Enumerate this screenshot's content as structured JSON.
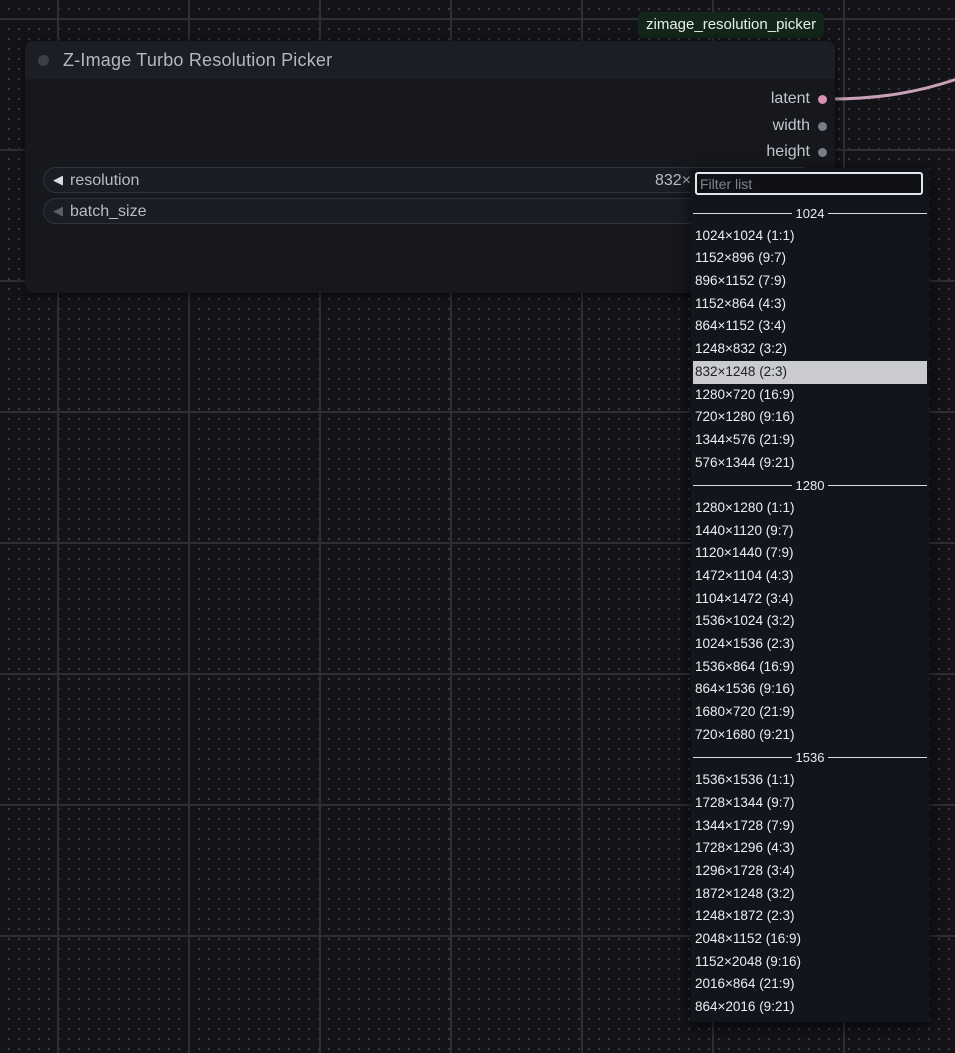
{
  "node": {
    "badge": "zimage_resolution_picker",
    "title": "Z-Image Turbo Resolution Picker",
    "outputs": [
      "latent",
      "width",
      "height"
    ],
    "widgets": {
      "resolution": {
        "label": "resolution",
        "value": "832×"
      },
      "batch_size": {
        "label": "batch_size"
      }
    }
  },
  "dropdown": {
    "filter_placeholder": "Filter list",
    "selected": "832×1248 (2:3)",
    "groups": [
      {
        "header": "1024",
        "items": [
          "1024×1024 (1:1)",
          "1152×896 (9:7)",
          "896×1152 (7:9)",
          "1152×864 (4:3)",
          "864×1152 (3:4)",
          "1248×832 (3:2)",
          "832×1248 (2:3)",
          "1280×720 (16:9)",
          "720×1280 (9:16)",
          "1344×576 (21:9)",
          "576×1344 (9:21)"
        ]
      },
      {
        "header": "1280",
        "items": [
          "1280×1280 (1:1)",
          "1440×1120 (9:7)",
          "1120×1440 (7:9)",
          "1472×1104 (4:3)",
          "1104×1472 (3:4)",
          "1536×1024 (3:2)",
          "1024×1536 (2:3)",
          "1536×864 (16:9)",
          "864×1536 (9:16)",
          "1680×720 (21:9)",
          "720×1680 (9:21)"
        ]
      },
      {
        "header": "1536",
        "items": [
          "1536×1536 (1:1)",
          "1728×1344 (9:7)",
          "1344×1728 (7:9)",
          "1728×1296 (4:3)",
          "1296×1728 (3:4)",
          "1872×1248 (3:2)",
          "1248×1872 (2:3)",
          "2048×1152 (16:9)",
          "1152×2048 (9:16)",
          "2016×864 (21:9)",
          "864×2016 (9:21)"
        ]
      }
    ]
  }
}
